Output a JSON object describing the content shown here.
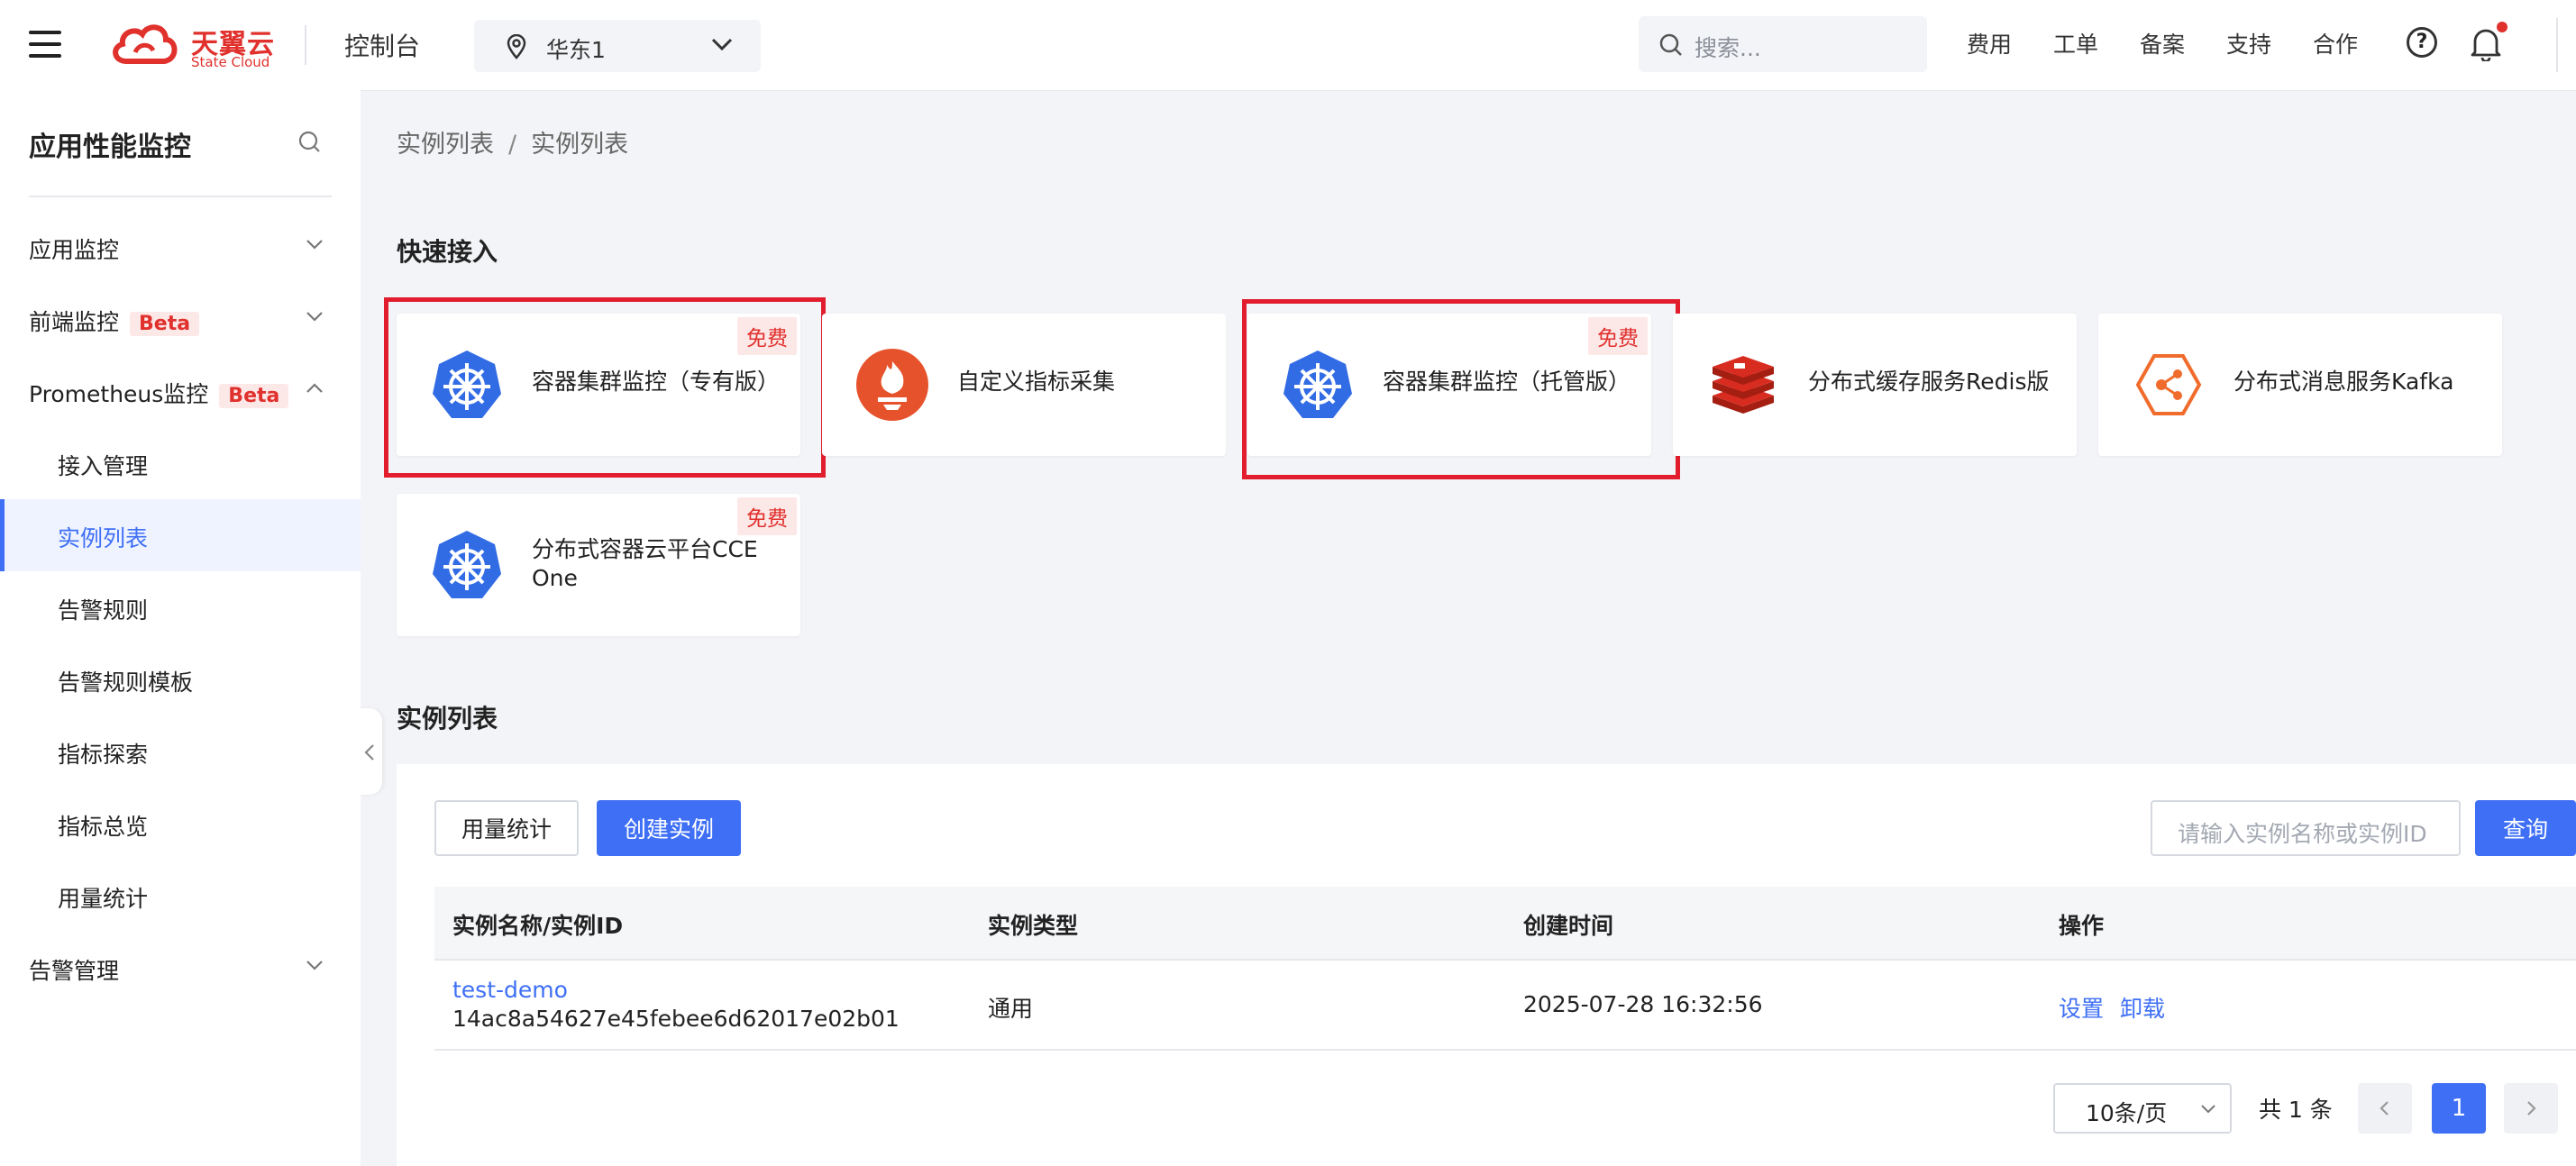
{
  "header": {
    "logo_cn": "天翼云",
    "logo_en": "State Cloud",
    "console": "控制台",
    "region": "华东1",
    "search_placeholder": "搜索...",
    "nav": [
      "费用",
      "工单",
      "备案",
      "支持",
      "合作"
    ]
  },
  "sidebar": {
    "title": "应用性能监控",
    "items": [
      {
        "label": "应用监控"
      },
      {
        "label": "前端监控",
        "badge": "Beta"
      },
      {
        "label": "Prometheus监控",
        "badge": "Beta"
      },
      {
        "label": "接入管理"
      },
      {
        "label": "实例列表"
      },
      {
        "label": "告警规则"
      },
      {
        "label": "告警规则模板"
      },
      {
        "label": "指标探索"
      },
      {
        "label": "指标总览"
      },
      {
        "label": "用量统计"
      },
      {
        "label": "告警管理"
      }
    ]
  },
  "breadcrumb": {
    "parent": "实例列表",
    "sep": "/",
    "current": "实例列表"
  },
  "quick_access": {
    "title": "快速接入",
    "free_label": "免费",
    "cards": [
      {
        "label": "容器集群监控（专有版）",
        "icon": "kubernetes-icon"
      },
      {
        "label": "自定义指标采集",
        "icon": "prometheus-icon"
      },
      {
        "label": "容器集群监控（托管版）",
        "icon": "kubernetes-icon"
      },
      {
        "label": "分布式缓存服务Redis版",
        "icon": "redis-icon"
      },
      {
        "label": "分布式消息服务Kafka",
        "icon": "kafka-icon"
      },
      {
        "label": "分布式容器云平台CCE One",
        "icon": "kubernetes-icon"
      }
    ]
  },
  "instances": {
    "title": "实例列表",
    "usage_button": "用量统计",
    "create_button": "创建实例",
    "search_placeholder": "请输入实例名称或实例ID",
    "query_button": "查询",
    "columns": [
      "实例名称/实例ID",
      "实例类型",
      "创建时间",
      "操作"
    ],
    "rows": [
      {
        "name": "test-demo",
        "id": "14ac8a54627e45febee6d62017e02b01",
        "type": "通用",
        "created": "2025-07-28 16:32:56",
        "actions": [
          "设置",
          "卸载"
        ]
      }
    ]
  },
  "pagination": {
    "page_size": "10条/页",
    "total": "共 1 条",
    "current_page": "1"
  },
  "colors": {
    "primary": "#3e6ff5",
    "brand_red": "#e0312d",
    "highlight": "#e11d2e"
  }
}
